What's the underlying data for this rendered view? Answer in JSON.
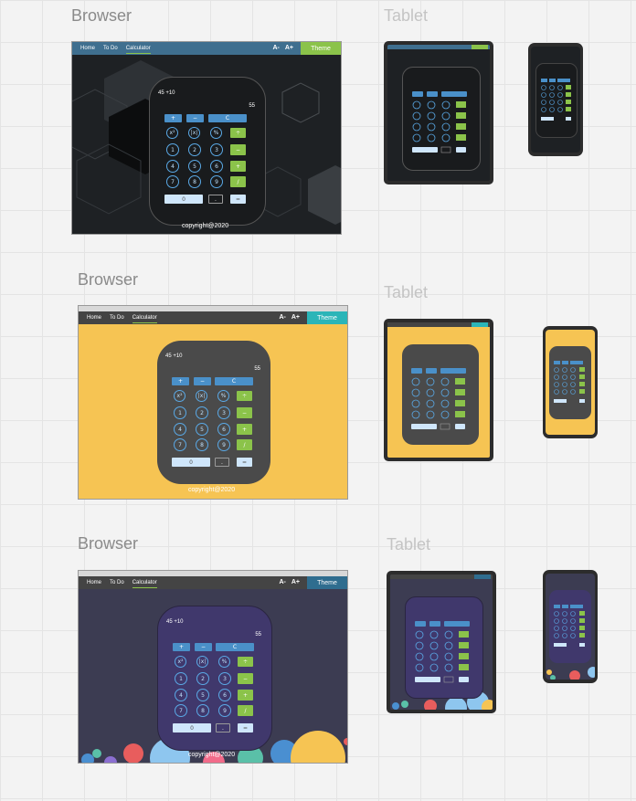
{
  "labels": {
    "browser": "Browser",
    "tablet": "Tablet"
  },
  "nav": {
    "home": "Home",
    "todo": "To Do",
    "calculator": "Calculator",
    "font_decrease": "A-",
    "font_increase": "A+",
    "theme": "Theme"
  },
  "calculator": {
    "expression": "45 +10",
    "result": "55",
    "keys_row1": [
      "+",
      "−",
      "C"
    ],
    "keys_row2": [
      "x²",
      "|x|",
      "%",
      "÷"
    ],
    "keys_row3": [
      "1",
      "2",
      "3",
      "−"
    ],
    "keys_row4": [
      "4",
      "5",
      "6",
      "+"
    ],
    "keys_row5": [
      "7",
      "8",
      "9",
      "/"
    ],
    "keys_row6": [
      "0",
      ".",
      "="
    ]
  },
  "footer": {
    "copyright": "copyright@2020"
  },
  "themes": [
    {
      "name": "dark-hex",
      "page": "#1e2124",
      "nav": "#3f6f8f",
      "theme_btn": "#8bc34a",
      "calc": "#191b1d"
    },
    {
      "name": "yellow",
      "page": "#f6c453",
      "nav": "#444444",
      "theme_btn": "#2bb5b8",
      "calc": "#4a4a4a"
    },
    {
      "name": "purple",
      "page": "#3c3c52",
      "nav": "#444444",
      "theme_btn": "#2f6d8f",
      "calc": "#40386c"
    }
  ]
}
